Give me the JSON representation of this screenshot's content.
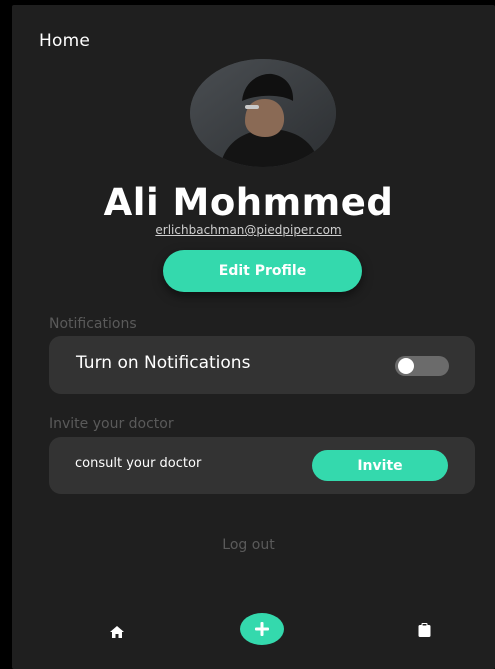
{
  "header": {
    "title": "Home"
  },
  "profile": {
    "name": "Ali Mohmmed",
    "email": "erlichbachman@piedpiper.com",
    "edit_label": "Edit Profile"
  },
  "notifications": {
    "section_label": "Notifications",
    "toggle_label": "Turn on Notifications",
    "enabled": false
  },
  "invite": {
    "section_label": "Invite your doctor",
    "text": "consult your doctor",
    "button_label": "Invite"
  },
  "logout": {
    "label": "Log out"
  },
  "bottom_nav": {
    "items": [
      {
        "icon": "home-icon"
      },
      {
        "icon": "plus-icon"
      },
      {
        "icon": "clipboard-icon"
      }
    ]
  },
  "colors": {
    "accent": "#34d9ad",
    "background": "#1f1f1f",
    "card": "#333333",
    "muted_text": "#5a5a5a"
  }
}
